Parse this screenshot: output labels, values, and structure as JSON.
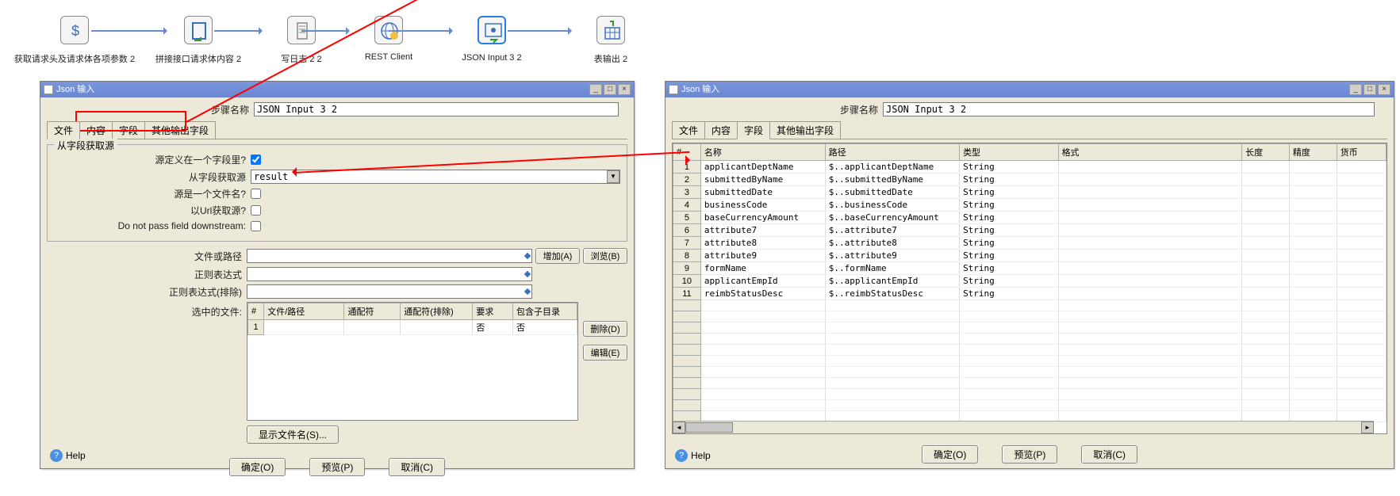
{
  "workflow": {
    "steps": [
      {
        "label": "获取请求头及请求体各项参数 2"
      },
      {
        "label": "拼接接口请求体内容 2"
      },
      {
        "label": "写日志 2 2"
      },
      {
        "label": "REST Client"
      },
      {
        "label": "JSON Input 3 2"
      },
      {
        "label": "表输出 2"
      }
    ]
  },
  "dialog_left": {
    "title": "Json 输入",
    "step_name_label": "步骤名称",
    "step_name_value": "JSON Input 3 2",
    "tabs": [
      "文件",
      "内容",
      "字段",
      "其他输出字段"
    ],
    "fieldset_legend": "从字段获取源",
    "source_in_field_label": "源定义在一个字段里?",
    "source_in_field_checked": true,
    "from_field_label": "从字段获取源",
    "from_field_value": "result",
    "is_filename_label": "源是一个文件名?",
    "is_filename_checked": false,
    "read_url_label": "以Url获取源?",
    "read_url_checked": false,
    "no_pass_label": "Do not pass field downstream:",
    "no_pass_checked": false,
    "file_or_path_label": "文件或路径",
    "regex_label": "正则表达式",
    "regex_excl_label": "正则表达式(排除)",
    "selected_files_label": "选中的文件:",
    "btn_add": "增加(A)",
    "btn_browse": "浏览(B)",
    "btn_delete": "删除(D)",
    "btn_edit": "编辑(E)",
    "btn_show": "显示文件名(S)...",
    "file_cols": [
      "#",
      "文件/路径",
      "通配符",
      "通配符(排除)",
      "要求",
      "包含子目录"
    ],
    "file_row": {
      "req": "否",
      "inc": "否"
    },
    "footer": {
      "ok": "确定(O)",
      "preview": "预览(P)",
      "cancel": "取消(C)"
    },
    "help": "Help"
  },
  "dialog_right": {
    "title": "Json 输入",
    "step_name_label": "步骤名称",
    "step_name_value": "JSON Input 3 2",
    "tabs": [
      "文件",
      "内容",
      "字段",
      "其他输出字段"
    ],
    "columns": [
      "#",
      "名称",
      "路径",
      "类型",
      "格式",
      "长度",
      "精度",
      "货币"
    ],
    "rows": [
      {
        "n": "1",
        "name": "applicantDeptName",
        "path": "$..applicantDeptName",
        "type": "String"
      },
      {
        "n": "2",
        "name": "submittedByName",
        "path": "$..submittedByName",
        "type": "String"
      },
      {
        "n": "3",
        "name": "submittedDate",
        "path": "$..submittedDate",
        "type": "String"
      },
      {
        "n": "4",
        "name": "businessCode",
        "path": "$..businessCode",
        "type": "String"
      },
      {
        "n": "5",
        "name": "baseCurrencyAmount",
        "path": "$..baseCurrencyAmount",
        "type": "String"
      },
      {
        "n": "6",
        "name": "attribute7",
        "path": "$..attribute7",
        "type": "String"
      },
      {
        "n": "7",
        "name": "attribute8",
        "path": "$..attribute8",
        "type": "String"
      },
      {
        "n": "8",
        "name": "attribute9",
        "path": "$..attribute9",
        "type": "String"
      },
      {
        "n": "9",
        "name": "formName",
        "path": "$..formName",
        "type": "String"
      },
      {
        "n": "10",
        "name": "applicantEmpId",
        "path": "$..applicantEmpId",
        "type": "String"
      },
      {
        "n": "11",
        "name": "reimbStatusDesc",
        "path": "$..reimbStatusDesc",
        "type": "String"
      }
    ],
    "footer": {
      "ok": "确定(O)",
      "preview": "预览(P)",
      "cancel": "取消(C)"
    },
    "help": "Help"
  }
}
